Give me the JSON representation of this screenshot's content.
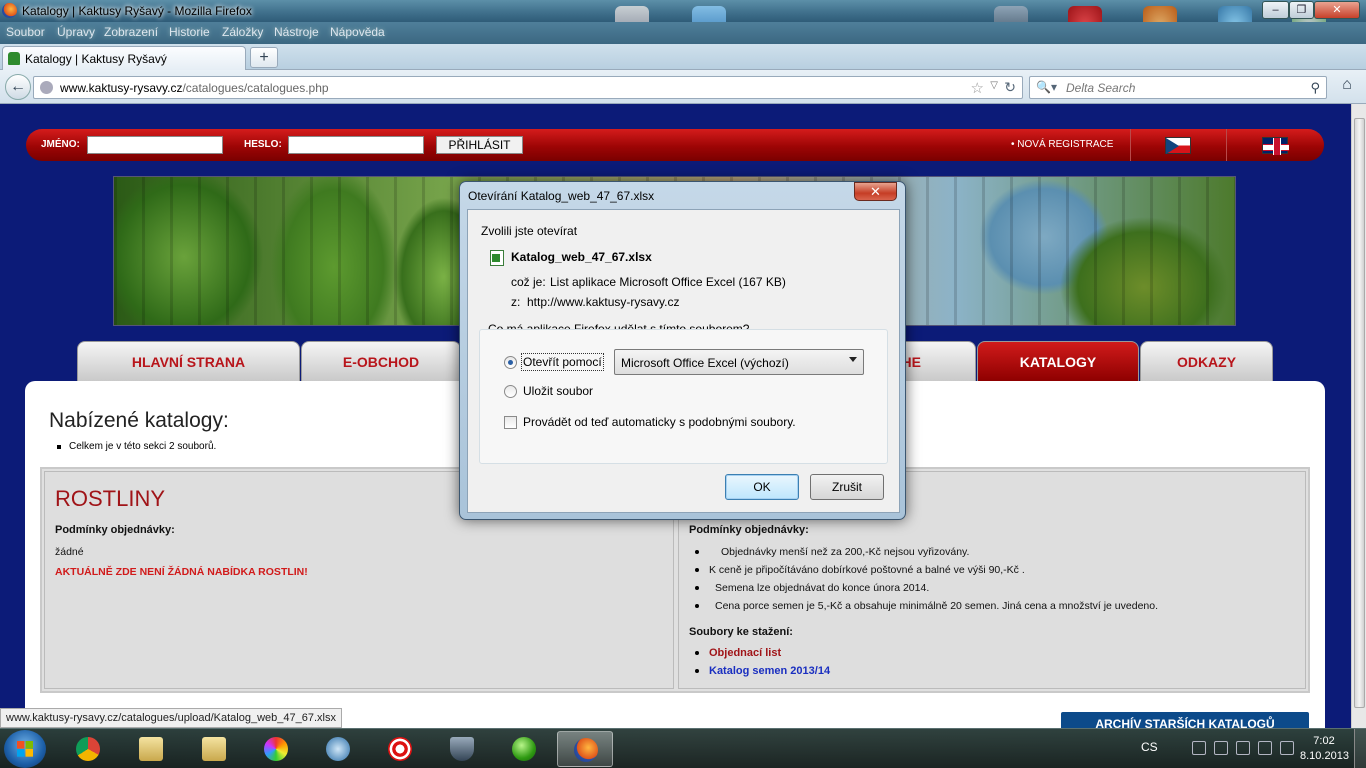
{
  "window": {
    "title": "Katalogy | Kaktusy Ryšavý - Mozilla Firefox",
    "menu": [
      "Soubor",
      "Úpravy",
      "Zobrazení",
      "Historie",
      "Záložky",
      "Nástroje",
      "Nápověda"
    ],
    "controls": {
      "minimize": "‒",
      "maximize": "❐",
      "close": "✕"
    }
  },
  "tabs": [
    {
      "label": "Katalogy | Kaktusy Ryšavý"
    }
  ],
  "new_tab_label": "+",
  "navbar": {
    "back_glyph": "←",
    "url_domain": "www.kaktusy-rysavy.cz",
    "url_path": "/catalogues/catalogues.php",
    "search_placeholder": "Delta Search",
    "icons": [
      "globe-icon",
      "star-icon",
      "reload-icon",
      "magnifier-icon",
      "home-icon"
    ]
  },
  "login": {
    "name_label": "JMÉNO:",
    "password_label": "HESLO:",
    "submit_label": "PŘIHLÁSIT",
    "register_label": "•  NOVÁ REGISTRACE"
  },
  "nav": {
    "items": [
      "HLAVNÍ STRANA",
      "E-OBCHOD",
      "HE",
      "KATALOGY",
      "ODKAZY"
    ],
    "active": "KATALOGY"
  },
  "content": {
    "heading": "Nabízené katalogy:",
    "count_text": "Celkem je v této sekci 2 souborů.",
    "left": {
      "title": "ROSTLINY",
      "conditions_label": "Podmínky objednávky:",
      "conditions_value": "žádné",
      "notice": "AKTUÁLNĚ ZDE NENÍ ŽÁDNÁ NABÍDKA ROSTLIN!"
    },
    "right": {
      "conditions_label": "Podmínky objednávky:",
      "conditions": [
        "Objednávky menší než za 200,-Kč nejsou vyřizovány.",
        "K ceně je připočítáváno dobírkové poštovné a balné ve výši 90,-Kč .",
        "Semena lze objednávat do konce února 2014.",
        "Cena porce semen je 5,-Kč a obsahuje minimálně 20 semen. Jiná cena a množství je uvedeno."
      ],
      "downloads_label": "Soubory ke stažení:",
      "downloads": [
        {
          "label": "Objednací list",
          "color": "#a01418"
        },
        {
          "label": "Katalog semen 2013/14",
          "color": "#1a2fc0"
        }
      ]
    },
    "archive_label": "ARCHÍV STARŠÍCH KATALOGŮ"
  },
  "status_url": "www.kaktusy-rysavy.cz/catalogues/upload/Katalog_web_47_67.xlsx",
  "dialog": {
    "title": "Otevírání Katalog_web_47_67.xlsx",
    "close_glyph": "✕",
    "intro": "Zvolili jste otevírat",
    "filename": "Katalog_web_47_67.xlsx",
    "type_label": "což je:",
    "type_value": "List aplikace Microsoft Office Excel (167 KB)",
    "from_label": "z:",
    "from_value": "http://www.kaktusy-rysavy.cz",
    "question": "Co má aplikace Firefox udělat s tímto souborem?",
    "open_with_label": "Otevřít pomocí",
    "open_with_value": "Microsoft Office Excel (výchozí)",
    "save_label": "Uložit soubor",
    "auto_label": "Provádět od teď automaticky s podobnými soubory.",
    "selected_option": "open",
    "auto_checked": false,
    "ok_label": "OK",
    "cancel_label": "Zrušit"
  },
  "taskbar": {
    "apps": [
      "chrome-icon",
      "alp-icon",
      "alp-icon",
      "paint-icon",
      "pl-icon",
      "target-icon",
      "shield-icon",
      "green-ball-icon",
      "firefox-icon"
    ],
    "active_app": "firefox-icon",
    "lang": "CS",
    "time": "7:02",
    "date": "8.10.2013"
  },
  "colors": {
    "accent_red": "#b8151b",
    "page_bg": "#0c1b78",
    "archive_bg": "#0c4a8a"
  }
}
